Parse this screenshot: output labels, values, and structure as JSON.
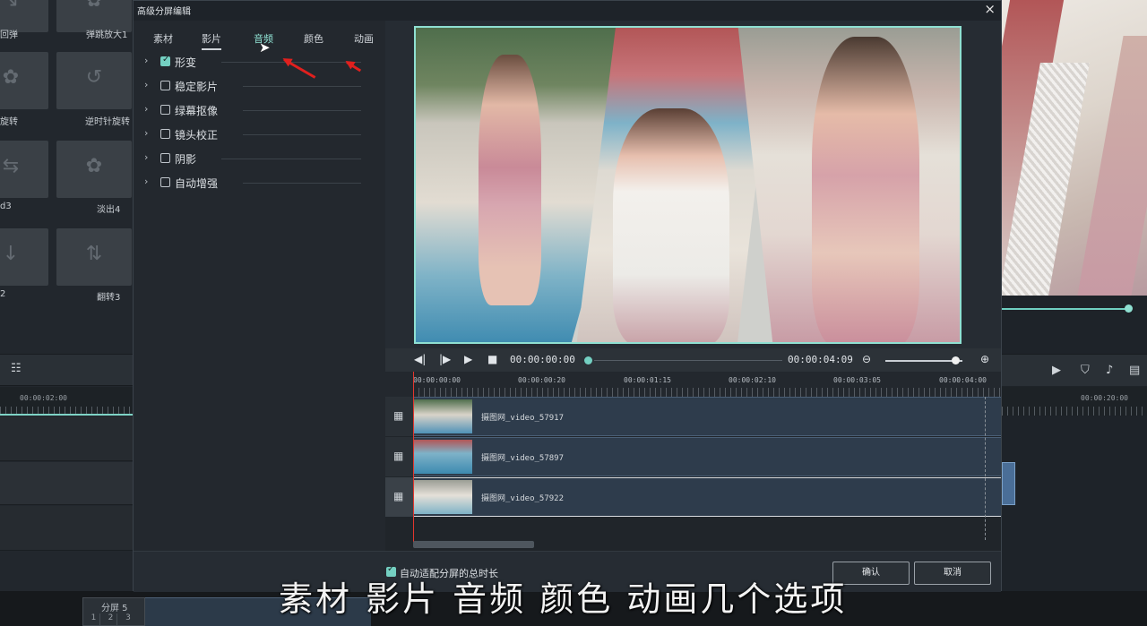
{
  "effects_panel": {
    "tiles": [
      {
        "label": "回弹"
      },
      {
        "label": "弹跳放大1"
      },
      {
        "label": "旋转"
      },
      {
        "label": "逆时针旋转"
      },
      {
        "label": "d3"
      },
      {
        "label": "淡出4"
      },
      {
        "label": "2"
      },
      {
        "label": "翻转3"
      }
    ]
  },
  "bg_timeline": {
    "left_time": "00:00:02:00",
    "right_time": "00:00:20:00"
  },
  "bg_split": {
    "label": "分屏 5",
    "cells": [
      "1",
      "2",
      "3"
    ]
  },
  "dialog": {
    "title": "高级分屏编辑",
    "close_glyph": "×",
    "tabs": [
      {
        "label": "素材"
      },
      {
        "label": "影片"
      },
      {
        "label": "音频"
      },
      {
        "label": "颜色"
      },
      {
        "label": "动画"
      }
    ],
    "active_tab": "影片",
    "options": [
      {
        "label": "形变",
        "checked": true
      },
      {
        "label": "稳定影片",
        "checked": false
      },
      {
        "label": "绿幕抠像",
        "checked": false
      },
      {
        "label": "镜头校正",
        "checked": false
      },
      {
        "label": "阴影",
        "checked": false
      },
      {
        "label": "自动增强",
        "checked": false
      }
    ],
    "transport": {
      "current_time": "00:00:00:00",
      "total_time": "00:00:04:09"
    },
    "ruler": [
      "00:00:00:00",
      "00:00:00:20",
      "00:00:01:15",
      "00:00:02:10",
      "00:00:03:05",
      "00:00:04:00"
    ],
    "clips": [
      {
        "name": "摄图网_video_57917"
      },
      {
        "name": "摄图网_video_57897"
      },
      {
        "name": "摄图网_video_57922"
      }
    ],
    "footer": {
      "autofit_label": "自动适配分屏的总时长",
      "confirm_label": "确认",
      "cancel_label": "取消"
    }
  },
  "caption": "素材 影片 音频 颜色 动画几个选项",
  "colors": {
    "accent": "#74d0c2",
    "annotation_arrow": "#e0201e",
    "playhead": "#e2362e"
  }
}
